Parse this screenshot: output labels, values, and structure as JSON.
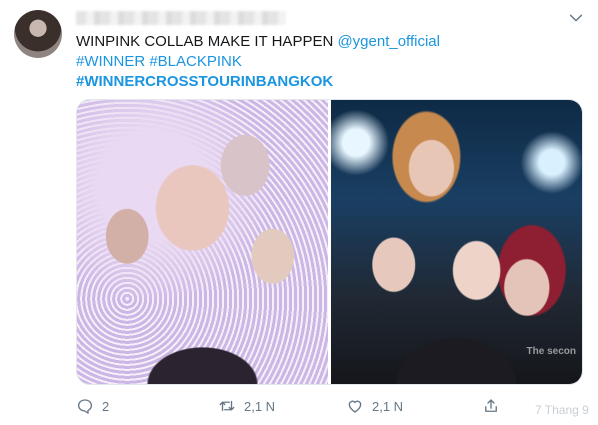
{
  "tweet": {
    "line1_text": "WINPINK COLLAB MAKE IT HAPPEN ",
    "mention": "@ygent_official",
    "line2_hashtags": "#WINNER #BLACKPINK",
    "line3_hashtag": "#WINNERCROSSTOURINBANGKOK"
  },
  "actions": {
    "reply_count": "2",
    "retweet_count": "2,1 N",
    "like_count": "2,1 N"
  },
  "background_fragments": {
    "faint_text_1": "The secon",
    "faint_text_2": "7 Thang 9"
  },
  "icons": {
    "menu": "chevron-down-icon",
    "reply": "comment-icon",
    "retweet": "retweet-icon",
    "like": "heart-icon",
    "share": "share-icon"
  },
  "colors": {
    "link": "#1b95e0",
    "text": "#14171a",
    "muted": "#657786"
  }
}
